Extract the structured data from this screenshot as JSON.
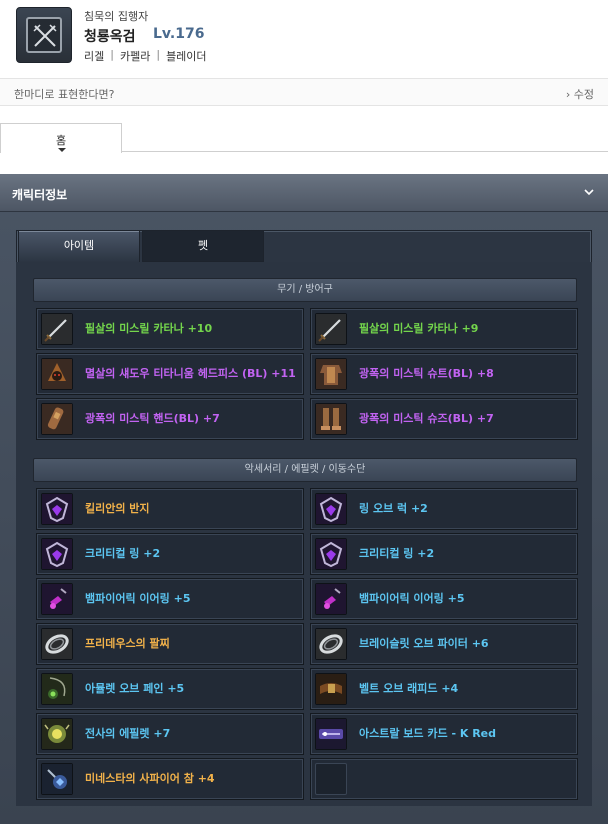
{
  "header": {
    "guild": "침묵의 집행자",
    "name": "청룡옥검",
    "level": "Lv.176",
    "meta": [
      "리겔",
      "카펠라",
      "블레이더"
    ],
    "meta_sep": "|"
  },
  "comment": {
    "placeholder": "한마디로 표현한다면?",
    "edit": "› 수정"
  },
  "home_tab": "홈",
  "panel_title": "캐릭터정보",
  "tabs": {
    "items": "아이템",
    "pet": "펫"
  },
  "sections": {
    "weapon": "무기 / 방어구",
    "accessory": "악세서리 / 에필렛 / 이동수단"
  },
  "colors": {
    "green": "#74d64c",
    "purple": "#c263f2",
    "blue": "#5cc6f2",
    "orange": "#f2b24a"
  },
  "weapons": [
    {
      "name": "필살의 미스릴 카타나 +10",
      "icon": "katana-icon"
    },
    {
      "name": "필살의 미스릴 카타나 +9",
      "icon": "katana-icon"
    },
    {
      "name": "멸살의 섀도우 티타니움 헤드피스 (BL) +11",
      "icon": "headpiece-icon"
    },
    {
      "name": "광폭의 미스틱 슈트(BL) +8",
      "icon": "suit-icon"
    },
    {
      "name": "광폭의 미스틱 핸드(BL) +7",
      "icon": "hand-icon"
    },
    {
      "name": "광폭의 미스틱 슈즈(BL) +7",
      "icon": "shoes-icon"
    }
  ],
  "accessories": [
    {
      "name": "킬리안의 반지",
      "icon": "ring-icon"
    },
    {
      "name": "링 오브 럭 +2",
      "icon": "ring-icon"
    },
    {
      "name": "크리티컬 링 +2",
      "icon": "ring-icon"
    },
    {
      "name": "크리티컬 링 +2",
      "icon": "ring-icon"
    },
    {
      "name": "뱀파이어릭 이어링 +5",
      "icon": "earring-icon"
    },
    {
      "name": "뱀파이어릭 이어링 +5",
      "icon": "earring-icon"
    },
    {
      "name": "프리데우스의 팔찌",
      "icon": "bracelet-icon"
    },
    {
      "name": "브레이슬릿 오브 파이터 +6",
      "icon": "bracelet-icon"
    },
    {
      "name": "아뮬렛 오브 페인 +5",
      "icon": "amulet-icon"
    },
    {
      "name": "벨트 오브 래피드 +4",
      "icon": "belt-icon"
    },
    {
      "name": "전사의 에필렛 +7",
      "icon": "epaulet-icon"
    },
    {
      "name": "아스트랄 보드 카드 - K Red",
      "icon": "board-card-icon"
    },
    {
      "name": "미네스타의 사파이어 참 +4",
      "icon": "charm-icon"
    }
  ]
}
